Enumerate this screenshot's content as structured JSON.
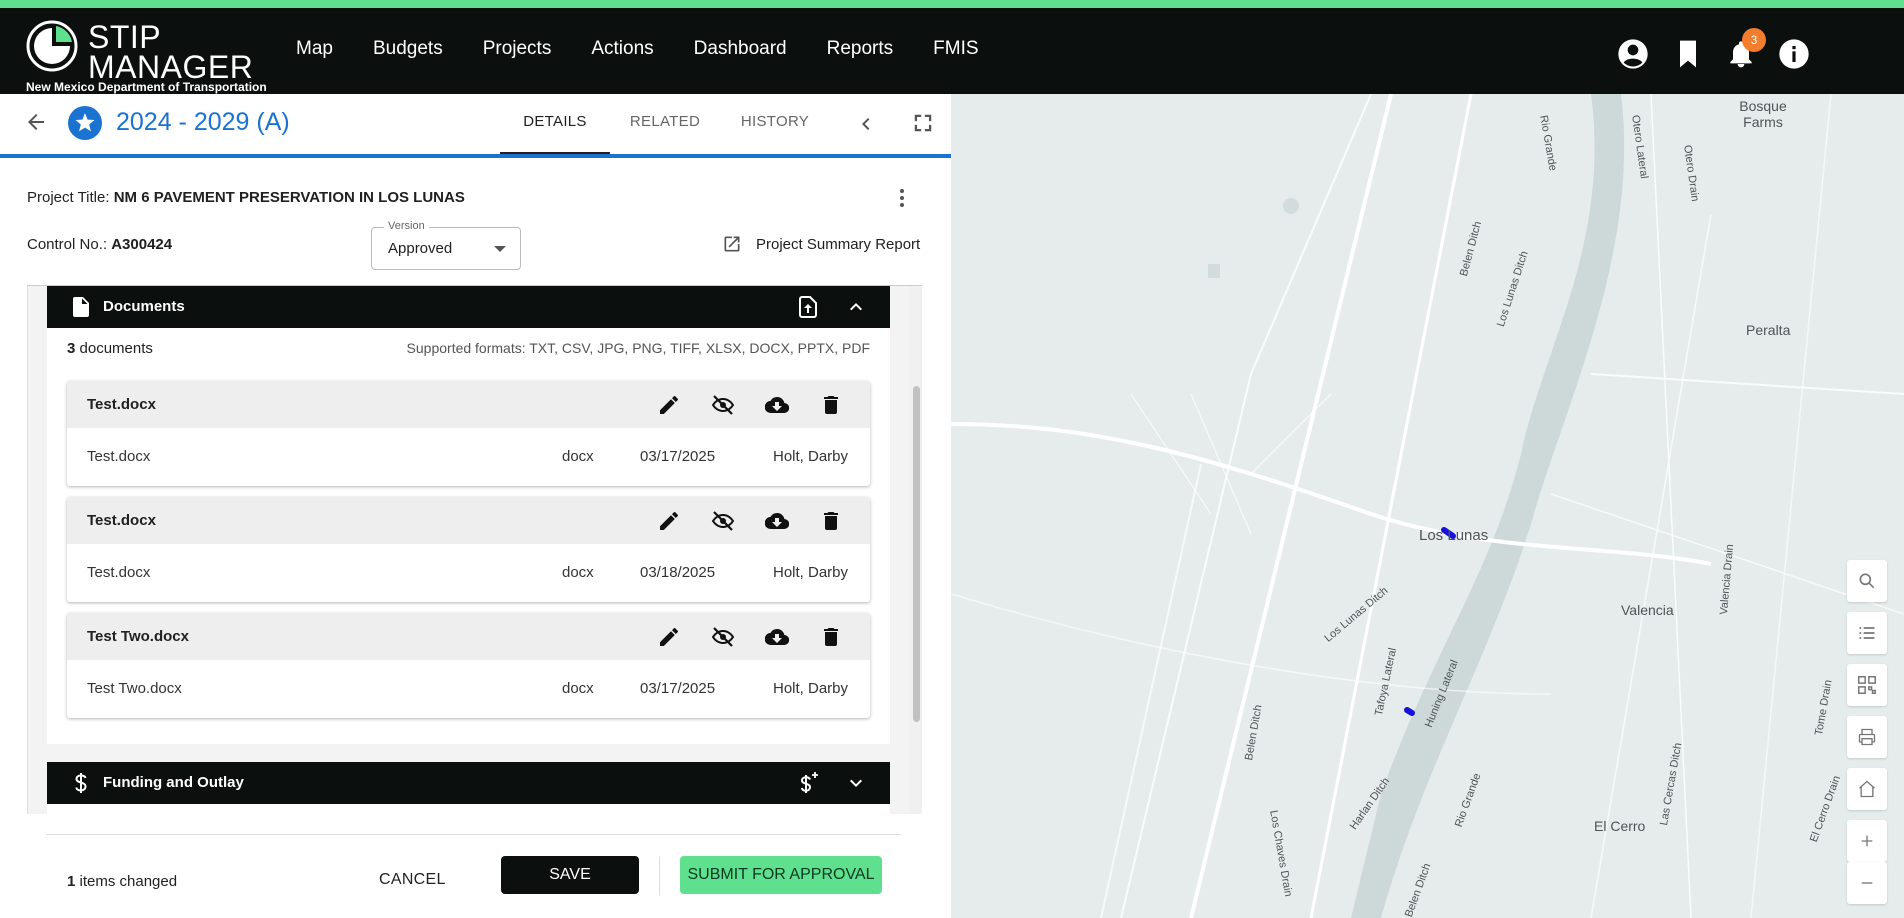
{
  "app": {
    "logo_line1": "STIP",
    "logo_line2": "MANAGER",
    "logo_subtitle": "New Mexico Department of Transportation",
    "nav": [
      "Map",
      "Budgets",
      "Projects",
      "Actions",
      "Dashboard",
      "Reports",
      "FMIS"
    ],
    "notification_count": "3",
    "accent_color": "#5ee08f",
    "header_color": "#0b0f0d",
    "link_color": "#1a73d1"
  },
  "header": {
    "title": "2024 - 2029 (A)",
    "tabs": [
      "DETAILS",
      "RELATED",
      "HISTORY"
    ],
    "active_tab": "DETAILS"
  },
  "project": {
    "title_label": "Project Title: ",
    "title_value": "NM 6 PAVEMENT PRESERVATION IN LOS LUNAS",
    "control_label": "Control No.: ",
    "control_value": "A300424",
    "version_label": "Version",
    "version_value": "Approved",
    "summary_report": "Project Summary Report"
  },
  "documents": {
    "title": "Documents",
    "count": "3",
    "count_suffix": " documents",
    "formats": "Supported formats: TXT, CSV, JPG, PNG, TIFF, XLSX, DOCX, PPTX, PDF",
    "items": [
      {
        "name": "Test.docx",
        "file": "Test.docx",
        "type": "docx",
        "date": "03/17/2025",
        "user": "Holt, Darby"
      },
      {
        "name": "Test.docx",
        "file": "Test.docx",
        "type": "docx",
        "date": "03/18/2025",
        "user": "Holt, Darby"
      },
      {
        "name": "Test Two.docx",
        "file": "Test Two.docx",
        "type": "docx",
        "date": "03/17/2025",
        "user": "Holt, Darby"
      }
    ]
  },
  "funding": {
    "title": "Funding and Outlay"
  },
  "footer": {
    "changed_count": "1",
    "changed_suffix": " items changed",
    "cancel": "CANCEL",
    "save": "SAVE",
    "submit": "SUBMIT FOR APPROVAL"
  },
  "map": {
    "labels": [
      "Bosque Farms",
      "Peralta",
      "Los Lunas",
      "Valencia",
      "El Cerro",
      "Rio Grande",
      "Rio Grande",
      "Belen Ditch",
      "Los Lunas Ditch",
      "Los Lunas Ditch",
      "Tafoya Lateral",
      "Huning Lateral",
      "Harlan Ditch",
      "Los Chaves Drain",
      "Belen Ditch",
      "Otero Lateral",
      "Otero Drain",
      "Valencia Drain",
      "Las Cercas Ditch",
      "Tome Drain",
      "El Cerro Drain",
      "Belen Ditch"
    ],
    "controls": [
      "search-icon",
      "list-icon",
      "qr-icon",
      "print-icon",
      "home-icon",
      "zoom-in-icon",
      "zoom-out-icon"
    ]
  }
}
